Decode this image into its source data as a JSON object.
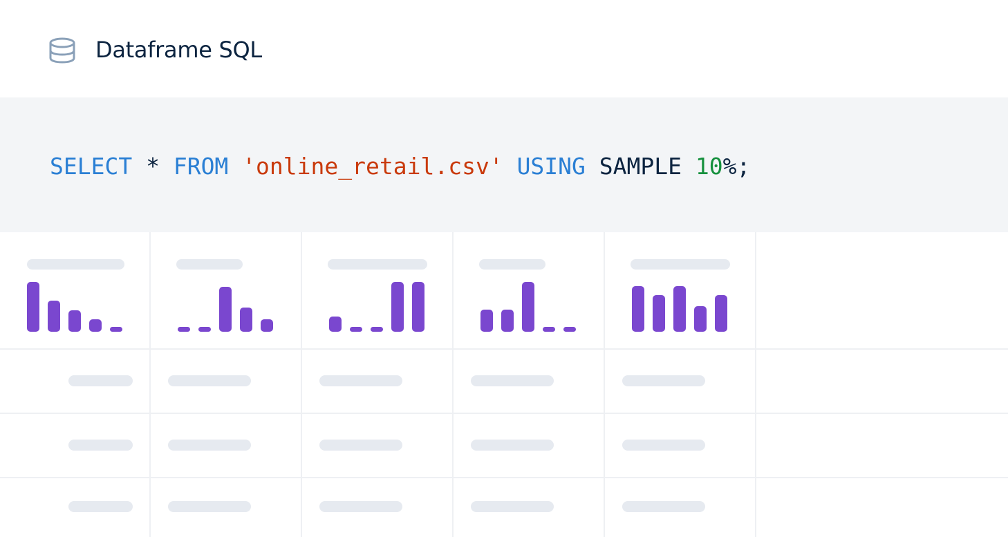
{
  "header": {
    "title": "Dataframe SQL",
    "icon": "database-icon"
  },
  "query": {
    "tokens": [
      {
        "text": "SELECT",
        "kind": "keyword"
      },
      {
        "text": " * ",
        "kind": "plain"
      },
      {
        "text": "FROM",
        "kind": "keyword"
      },
      {
        "text": " ",
        "kind": "plain"
      },
      {
        "text": "'online_retail.csv'",
        "kind": "string"
      },
      {
        "text": " ",
        "kind": "plain"
      },
      {
        "text": "USING",
        "kind": "keyword"
      },
      {
        "text": " SAMPLE ",
        "kind": "plain"
      },
      {
        "text": "10",
        "kind": "number"
      },
      {
        "text": "%;",
        "kind": "plain"
      }
    ]
  },
  "result_table": {
    "column_count": 5,
    "row_count": 3,
    "histograms": [
      [
        1.0,
        0.62,
        0.43,
        0.25,
        0.1
      ],
      [
        0.1,
        0.1,
        0.9,
        0.48,
        0.25
      ],
      [
        0.3,
        0.07,
        0.07,
        1.0,
        1.0
      ],
      [
        0.45,
        0.45,
        1.0,
        0.1,
        0.1
      ],
      [
        0.92,
        0.73,
        0.92,
        0.52,
        0.73
      ]
    ]
  },
  "colors": {
    "keyword": "#2a7fd4",
    "string": "#c93a0b",
    "number": "#15903d",
    "text": "#0c2440",
    "bar": "#7a47cf",
    "placeholder": "#e6eaf0",
    "code_bg": "#f3f5f7"
  }
}
